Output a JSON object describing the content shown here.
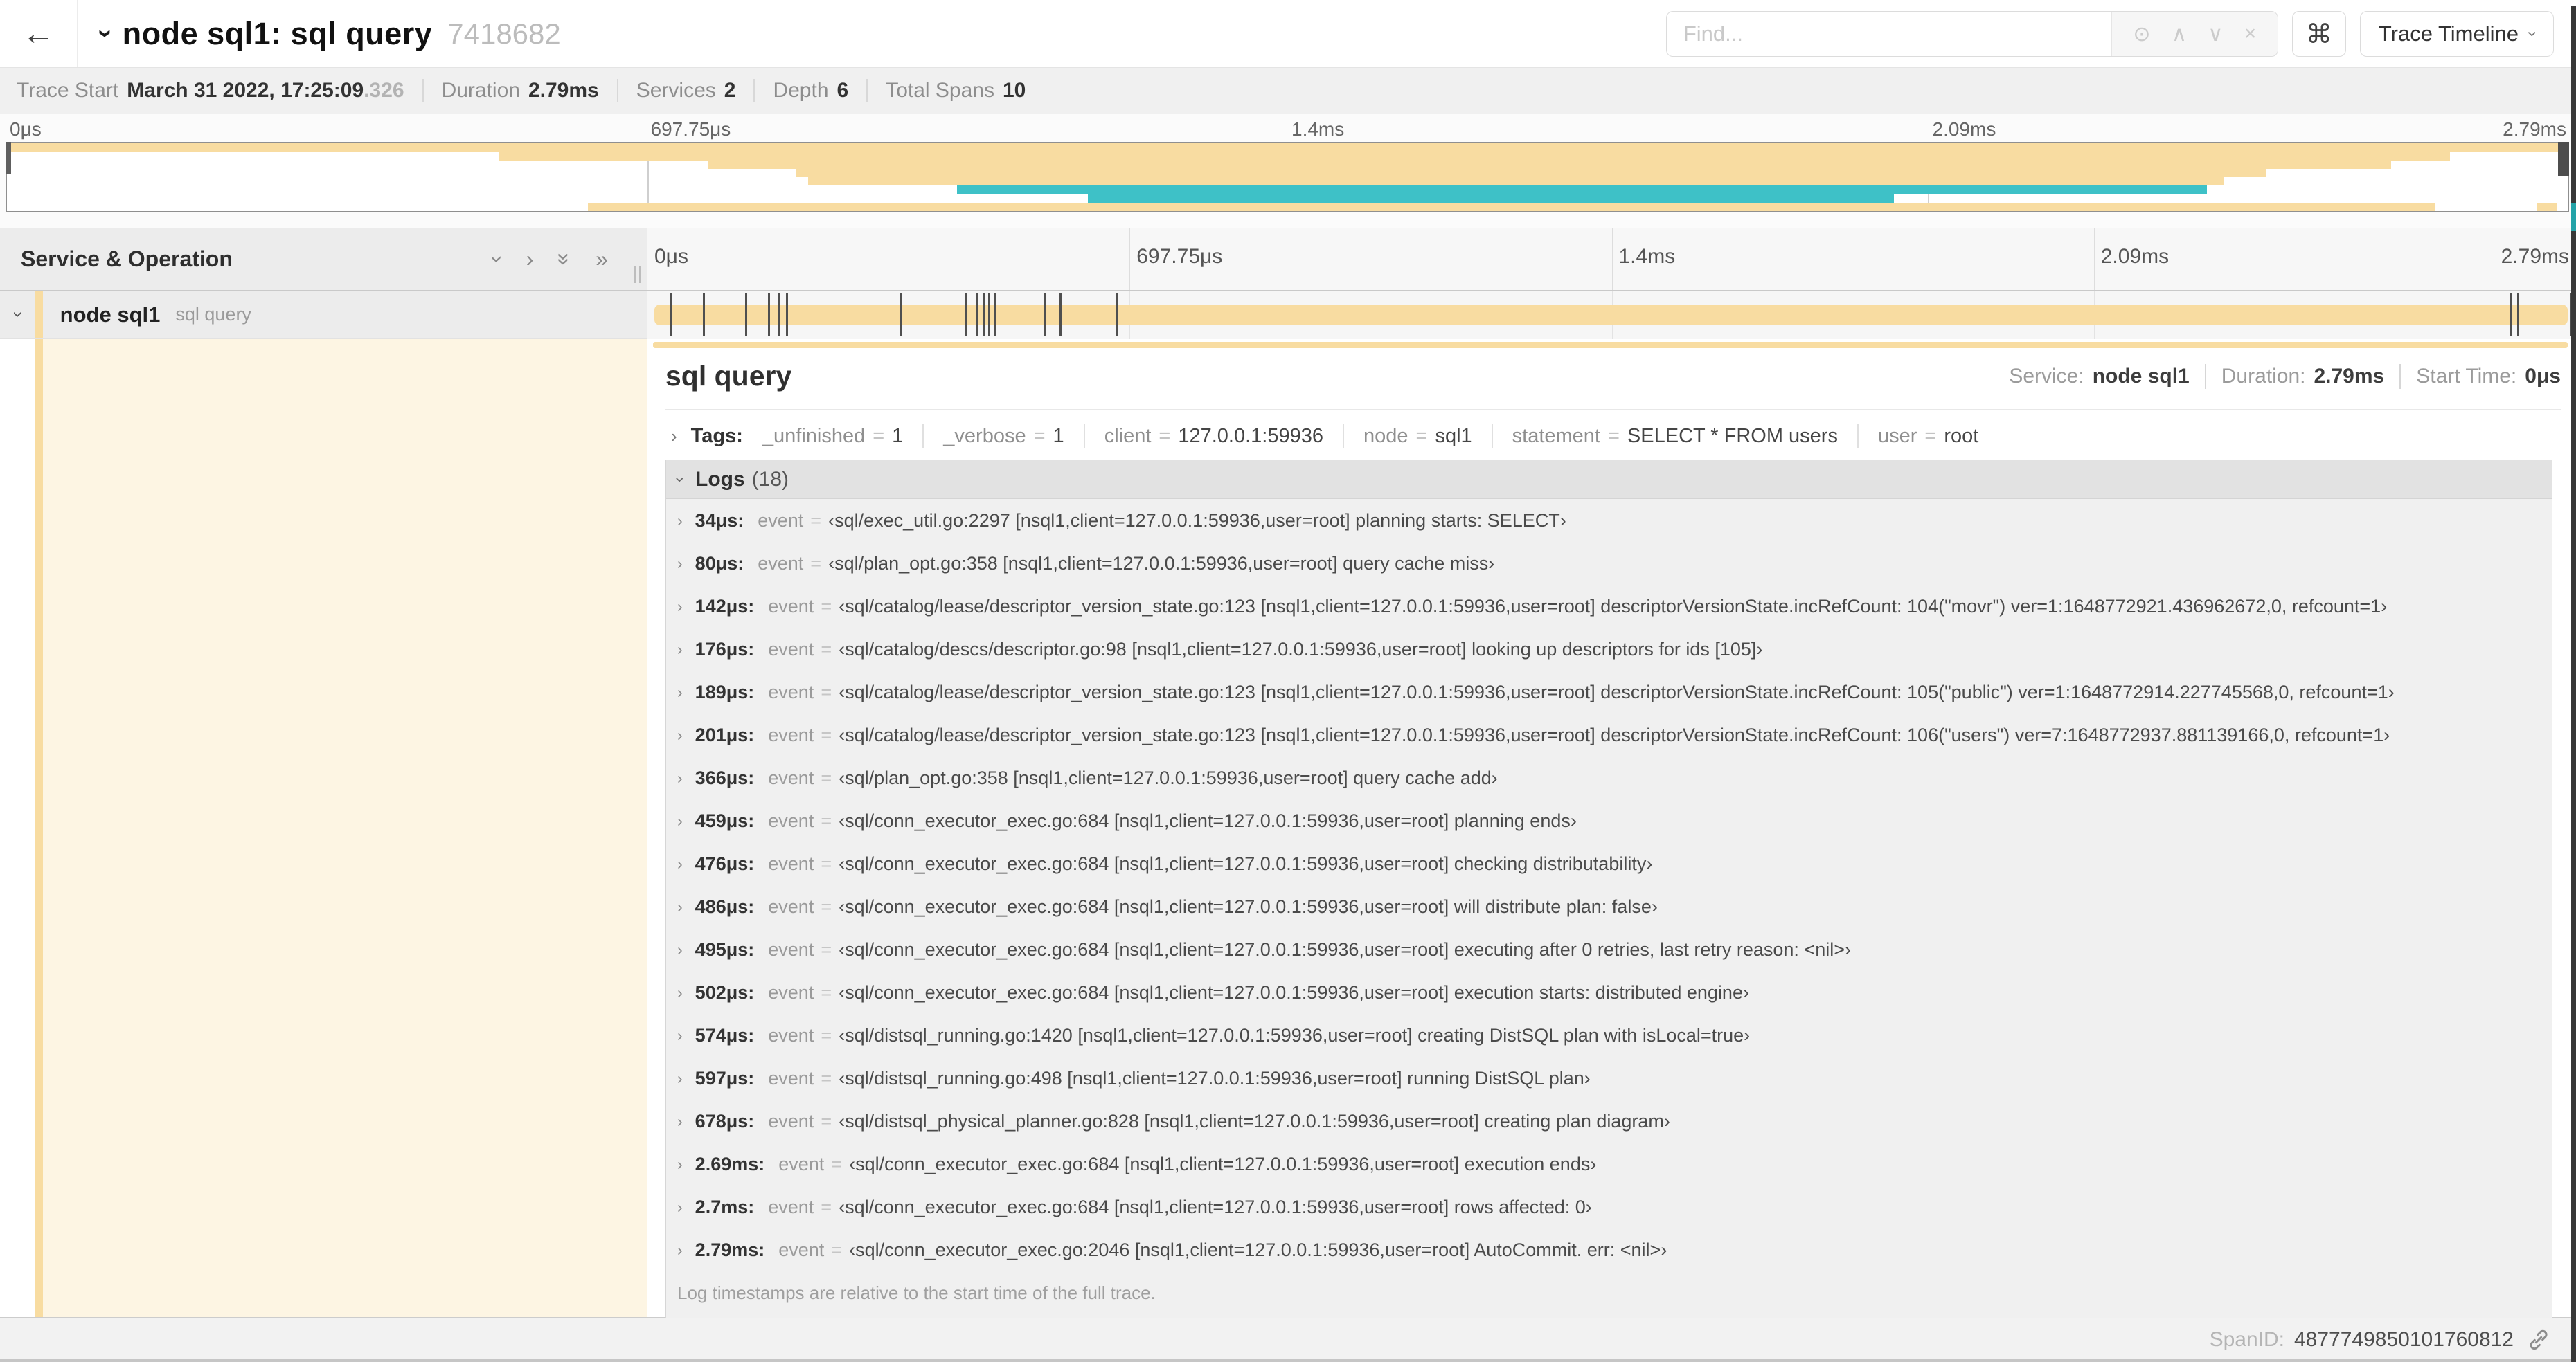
{
  "colors": {
    "span": "#F8DCA1",
    "secondary": "#3EC1C7",
    "rail": "#FDF5E3"
  },
  "header": {
    "back_icon": "←",
    "collapse_icon": "›",
    "title": "node sql1: sql query",
    "trace_id": "7418682",
    "find": {
      "placeholder": "Find...",
      "icons": [
        {
          "name": "locate-icon",
          "glyph": "⊙"
        },
        {
          "name": "prev-result-icon",
          "glyph": "∧"
        },
        {
          "name": "next-result-icon",
          "glyph": "∨"
        },
        {
          "name": "clear-search-icon",
          "glyph": "×"
        }
      ]
    },
    "shortcuts_icon": "⌘",
    "view_selector": {
      "label": "Trace Timeline",
      "chevron": "›"
    }
  },
  "summary": {
    "items": [
      {
        "label": "Trace Start",
        "value": "March 31 2022, 17:25:09",
        "suffix": ".326"
      },
      {
        "label": "Duration",
        "value": "2.79ms"
      },
      {
        "label": "Services",
        "value": "2"
      },
      {
        "label": "Depth",
        "value": "6"
      },
      {
        "label": "Total Spans",
        "value": "10"
      }
    ]
  },
  "timeline": {
    "ruler_ticks": [
      "0μs",
      "697.75μs",
      "1.4ms",
      "2.09ms",
      "2.79ms"
    ],
    "col_header": "Service & Operation",
    "collapse_icons": [
      {
        "name": "collapse-one-icon",
        "glyph": "›",
        "dir": "down"
      },
      {
        "name": "expand-one-icon",
        "glyph": "›",
        "dir": "right"
      },
      {
        "name": "collapse-all-icon",
        "glyph": "»",
        "dir": "down"
      },
      {
        "name": "expand-all-icon",
        "glyph": "»",
        "dir": "right"
      }
    ],
    "span": {
      "service": "node sql1",
      "operation": "sql query"
    },
    "log_marker_pcts": [
      1.2,
      2.9,
      5.1,
      6.3,
      6.8,
      7.2,
      13.1,
      16.5,
      17.1,
      17.4,
      17.7,
      18.0,
      20.6,
      21.4,
      24.3,
      96.6,
      97.0,
      99.7
    ],
    "minimap_rows": [
      [
        {
          "s": 0,
          "e": 100,
          "c": "span"
        }
      ],
      [
        {
          "s": 19.2,
          "e": 95.4,
          "c": "span"
        }
      ],
      [
        {
          "s": 27.4,
          "e": 93.1,
          "c": "span"
        }
      ],
      [
        {
          "s": 30.8,
          "e": 88.2,
          "c": "span"
        }
      ],
      [
        {
          "s": 31.3,
          "e": 86.6,
          "c": "span"
        }
      ],
      [
        {
          "s": 37.1,
          "e": 85.9,
          "c": "secondary"
        }
      ],
      [
        {
          "s": 42.2,
          "e": 73.7,
          "c": "secondary"
        }
      ],
      [
        {
          "s": 22.7,
          "e": 94.8,
          "c": "span"
        },
        {
          "s": 98.8,
          "e": 99.6,
          "c": "span"
        }
      ]
    ]
  },
  "detail": {
    "title": "sql query",
    "meta": [
      {
        "label": "Service:",
        "value": "node sql1"
      },
      {
        "label": "Duration:",
        "value": "2.79ms"
      },
      {
        "label": "Start Time:",
        "value": "0μs"
      }
    ],
    "tags_label": "Tags:",
    "tags": [
      {
        "key": "_unfinished",
        "value": "1"
      },
      {
        "key": "_verbose",
        "value": "1"
      },
      {
        "key": "client",
        "value": "127.0.0.1:59936"
      },
      {
        "key": "node",
        "value": "sql1"
      },
      {
        "key": "statement",
        "value": "SELECT * FROM users"
      },
      {
        "key": "user",
        "value": "root"
      }
    ],
    "logs_label": "Logs",
    "logs_count": "(18)",
    "log_field": "event",
    "logs": [
      {
        "time": "34μs:",
        "value": "‹sql/exec_util.go:2297 [nsql1,client=127.0.0.1:59936,user=root] planning starts: SELECT›"
      },
      {
        "time": "80μs:",
        "value": "‹sql/plan_opt.go:358 [nsql1,client=127.0.0.1:59936,user=root] query cache miss›"
      },
      {
        "time": "142μs:",
        "value": "‹sql/catalog/lease/descriptor_version_state.go:123 [nsql1,client=127.0.0.1:59936,user=root] descriptorVersionState.incRefCount: 104(\"movr\") ver=1:1648772921.436962672,0, refcount=1›"
      },
      {
        "time": "176μs:",
        "value": "‹sql/catalog/descs/descriptor.go:98 [nsql1,client=127.0.0.1:59936,user=root] looking up descriptors for ids [105]›"
      },
      {
        "time": "189μs:",
        "value": "‹sql/catalog/lease/descriptor_version_state.go:123 [nsql1,client=127.0.0.1:59936,user=root] descriptorVersionState.incRefCount: 105(\"public\") ver=1:1648772914.227745568,0, refcount=1›"
      },
      {
        "time": "201μs:",
        "value": "‹sql/catalog/lease/descriptor_version_state.go:123 [nsql1,client=127.0.0.1:59936,user=root] descriptorVersionState.incRefCount: 106(\"users\") ver=7:1648772937.881139166,0, refcount=1›"
      },
      {
        "time": "366μs:",
        "value": "‹sql/plan_opt.go:358 [nsql1,client=127.0.0.1:59936,user=root] query cache add›"
      },
      {
        "time": "459μs:",
        "value": "‹sql/conn_executor_exec.go:684 [nsql1,client=127.0.0.1:59936,user=root] planning ends›"
      },
      {
        "time": "476μs:",
        "value": "‹sql/conn_executor_exec.go:684 [nsql1,client=127.0.0.1:59936,user=root] checking distributability›"
      },
      {
        "time": "486μs:",
        "value": "‹sql/conn_executor_exec.go:684 [nsql1,client=127.0.0.1:59936,user=root] will distribute plan: false›"
      },
      {
        "time": "495μs:",
        "value": "‹sql/conn_executor_exec.go:684 [nsql1,client=127.0.0.1:59936,user=root] executing after 0 retries, last retry reason: <nil>›"
      },
      {
        "time": "502μs:",
        "value": "‹sql/conn_executor_exec.go:684 [nsql1,client=127.0.0.1:59936,user=root] execution starts: distributed engine›"
      },
      {
        "time": "574μs:",
        "value": "‹sql/distsql_running.go:1420 [nsql1,client=127.0.0.1:59936,user=root] creating DistSQL plan with isLocal=true›"
      },
      {
        "time": "597μs:",
        "value": "‹sql/distsql_running.go:498 [nsql1,client=127.0.0.1:59936,user=root] running DistSQL plan›"
      },
      {
        "time": "678μs:",
        "value": "‹sql/distsql_physical_planner.go:828 [nsql1,client=127.0.0.1:59936,user=root] creating plan diagram›"
      },
      {
        "time": "2.69ms:",
        "value": "‹sql/conn_executor_exec.go:684 [nsql1,client=127.0.0.1:59936,user=root] execution ends›"
      },
      {
        "time": "2.7ms:",
        "value": "‹sql/conn_executor_exec.go:684 [nsql1,client=127.0.0.1:59936,user=root] rows affected: 0›"
      },
      {
        "time": "2.79ms:",
        "value": "‹sql/conn_executor_exec.go:2046 [nsql1,client=127.0.0.1:59936,user=root] AutoCommit. err: <nil>›"
      }
    ],
    "note": "Log timestamps are relative to the start time of the full trace.",
    "footer_label": "SpanID:",
    "footer_value": "4877749850101760812"
  }
}
